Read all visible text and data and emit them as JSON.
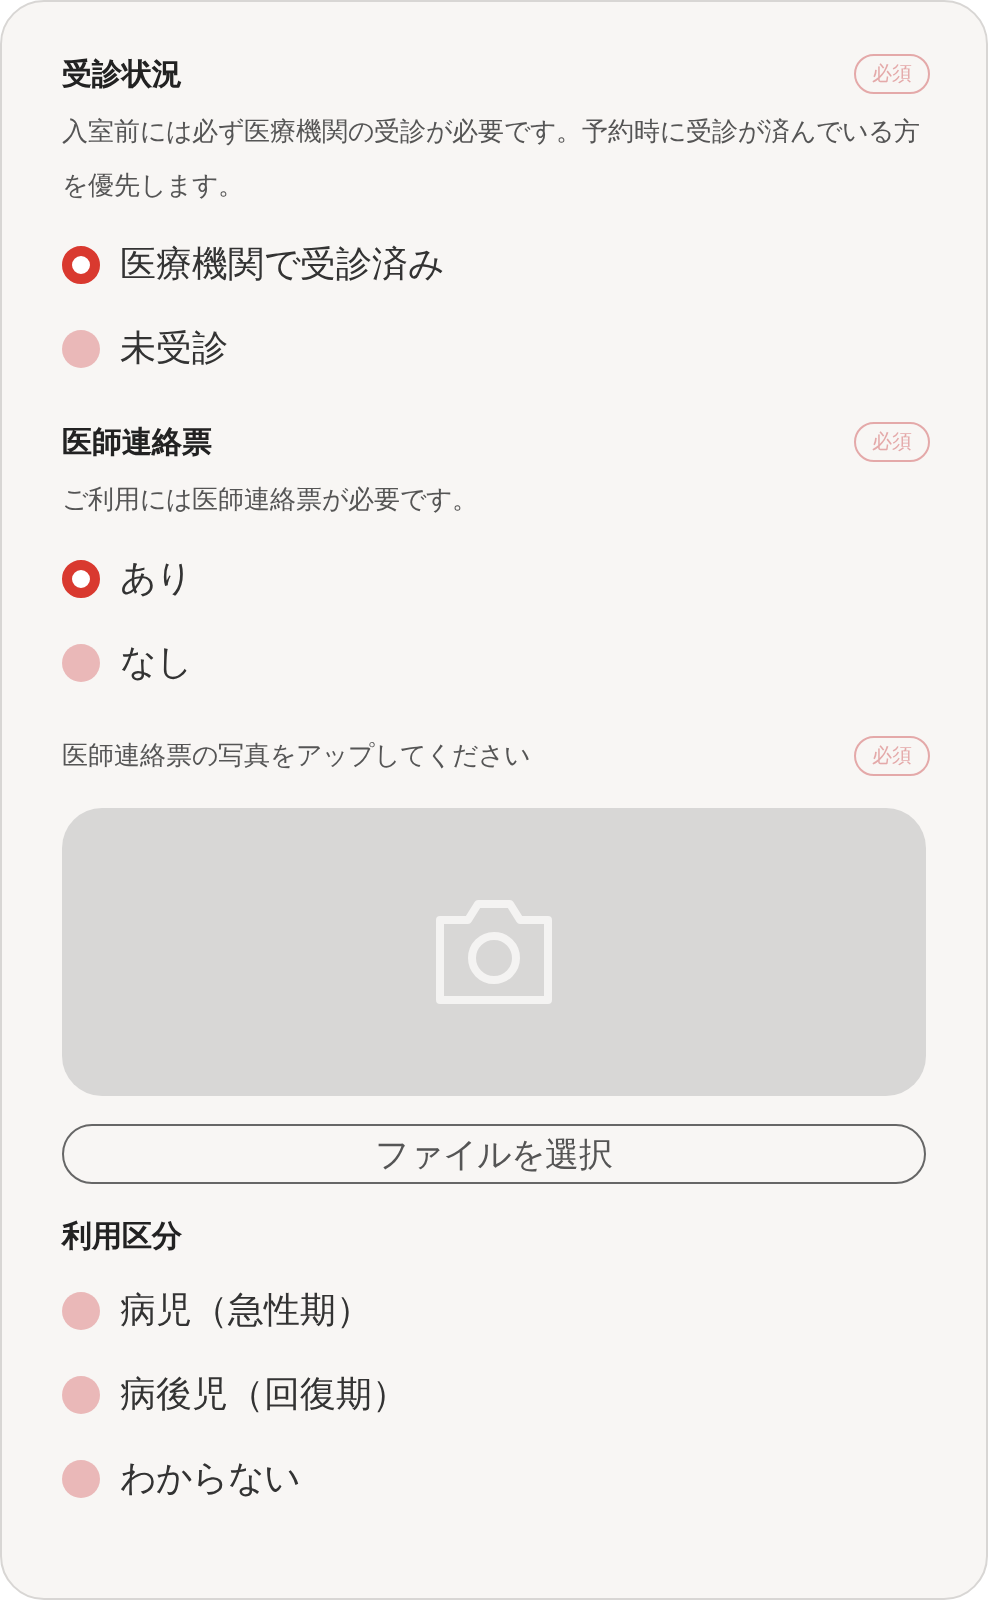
{
  "sections": [
    {
      "kind": "radio",
      "title": "受診状況",
      "required_badge": "必須",
      "description": "入室前には必ず医療機関の受診が必要です。予約時に受診が済んでいる方を優先します。",
      "options": [
        {
          "label": "医療機関で受診済み",
          "selected": true
        },
        {
          "label": "未受診",
          "selected": false
        }
      ]
    },
    {
      "kind": "radio",
      "title": "医師連絡票",
      "required_badge": "必須",
      "description": "ご利用には医師連絡票が必要です。",
      "options": [
        {
          "label": "あり",
          "selected": true
        },
        {
          "label": "なし",
          "selected": false
        }
      ]
    },
    {
      "kind": "upload",
      "label": "医師連絡票の写真をアップしてください",
      "required_badge": "必須",
      "button": "ファイルを選択"
    },
    {
      "kind": "radio",
      "title": "利用区分",
      "options": [
        {
          "label": "病児（急性期）",
          "selected": false
        },
        {
          "label": "病後児（回復期）",
          "selected": false
        },
        {
          "label": "わからない",
          "selected": false
        }
      ]
    }
  ]
}
